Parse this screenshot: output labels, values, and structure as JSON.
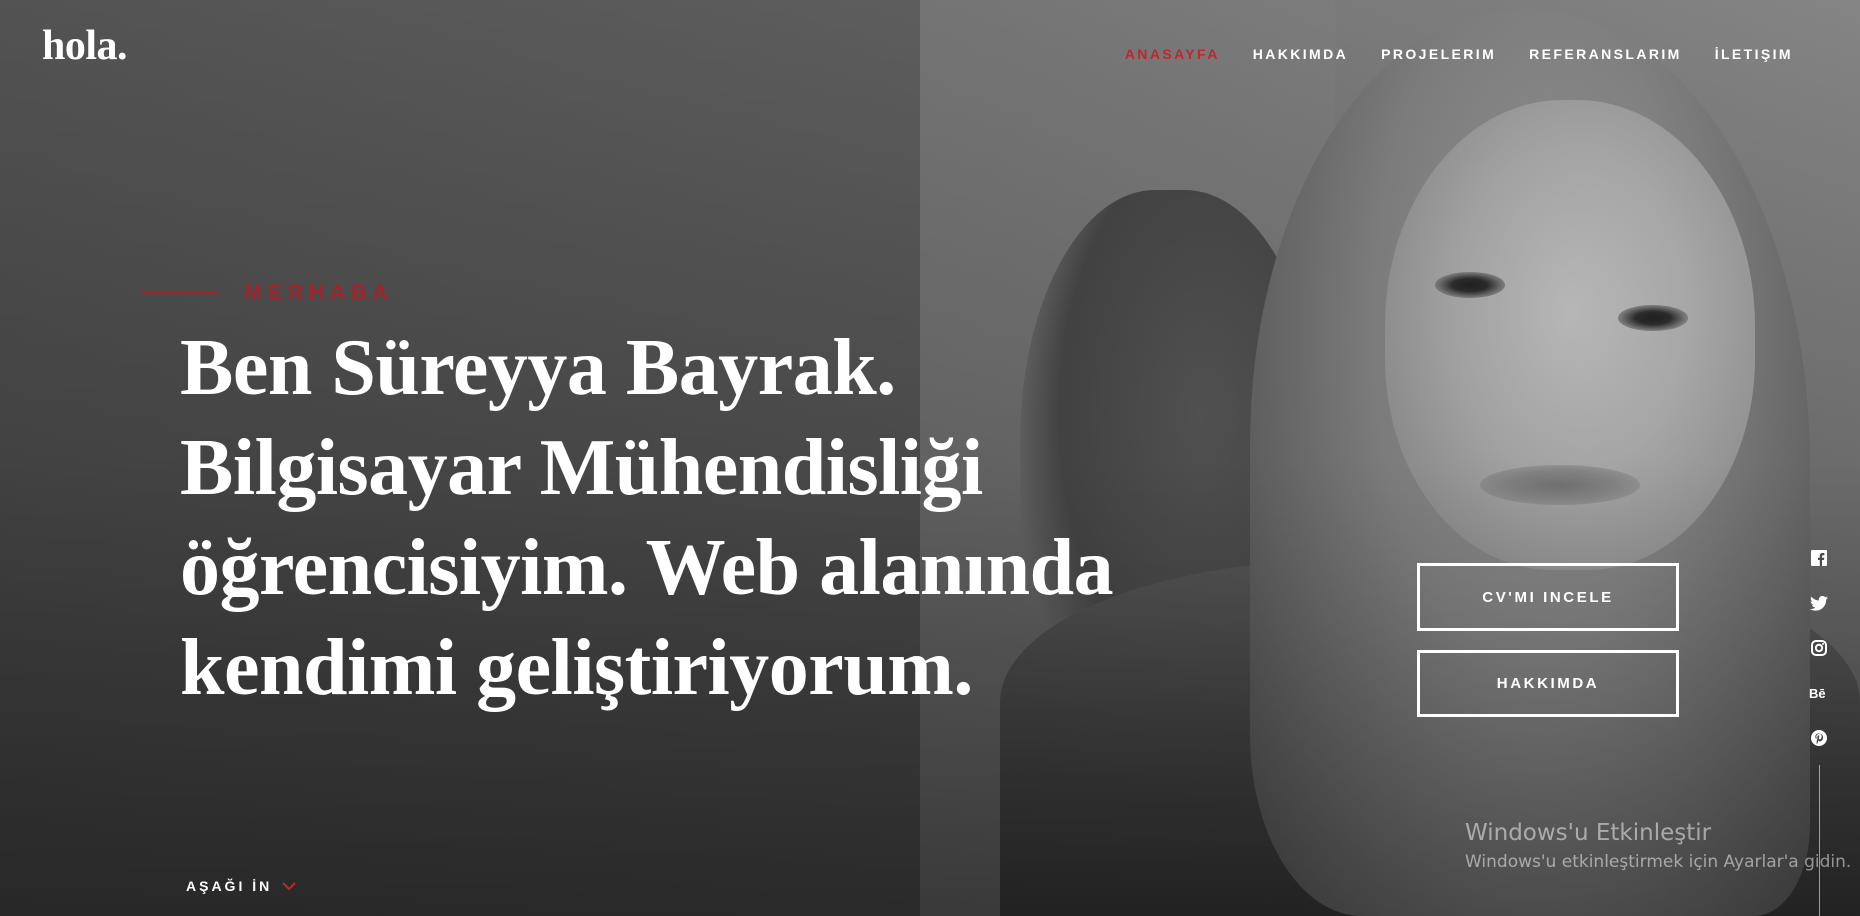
{
  "header": {
    "logo": "hola.",
    "nav": [
      {
        "label": "ANASAYFA",
        "active": true
      },
      {
        "label": "HAKKIMDA",
        "active": false
      },
      {
        "label": "PROJELERIM",
        "active": false
      },
      {
        "label": "REFERANSLARIM",
        "active": false
      },
      {
        "label": "İLETIŞIM",
        "active": false
      }
    ]
  },
  "hero": {
    "eyebrow": "MERHABA",
    "headline_lines": [
      "Ben Süreyya Bayrak.",
      "Bilgisayar Mühendisliği",
      "öğrencisiyim. Web alanında",
      "kendimi geliştiriyorum."
    ],
    "buttons": {
      "cv": "CV'MI INCELE",
      "about": "HAKKIMDA"
    },
    "scroll_down": "AŞAĞI İN"
  },
  "social": [
    {
      "icon": "facebook-icon"
    },
    {
      "icon": "twitter-icon"
    },
    {
      "icon": "instagram-icon"
    },
    {
      "icon": "behance-icon"
    },
    {
      "icon": "pinterest-icon"
    }
  ],
  "watermark": {
    "title": "Windows'u Etkinleştir",
    "subtitle": "Windows'u etkinleştirmek için Ayarlar'a gidin."
  },
  "colors": {
    "accent": "#c0262c",
    "eyebrow": "#a3232a",
    "text": "#ffffff"
  }
}
